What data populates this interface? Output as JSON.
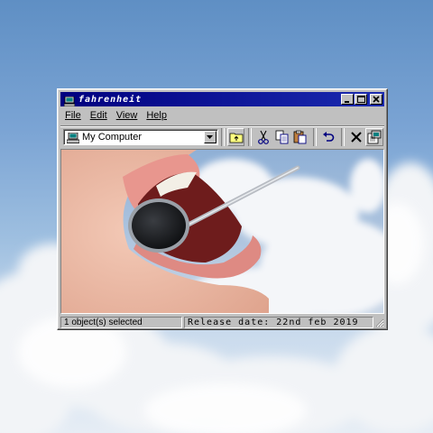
{
  "window": {
    "title": "fahrenheit",
    "menu": [
      {
        "label": "File"
      },
      {
        "label": "Edit"
      },
      {
        "label": "View"
      },
      {
        "label": "Help"
      }
    ],
    "address": {
      "value": "My Computer"
    },
    "toolbar_icons": [
      "up-folder-icon",
      "cut-icon",
      "copy-icon",
      "paste-icon",
      "undo-icon",
      "delete-icon",
      "properties-icon"
    ],
    "status": {
      "selection": "1 object(s) selected",
      "release": "Release date: 22nd feb 2019"
    }
  },
  "colors": {
    "titlebar": "#00007f",
    "window_face": "#c0c0c0",
    "sky": "#7ba4d4"
  }
}
